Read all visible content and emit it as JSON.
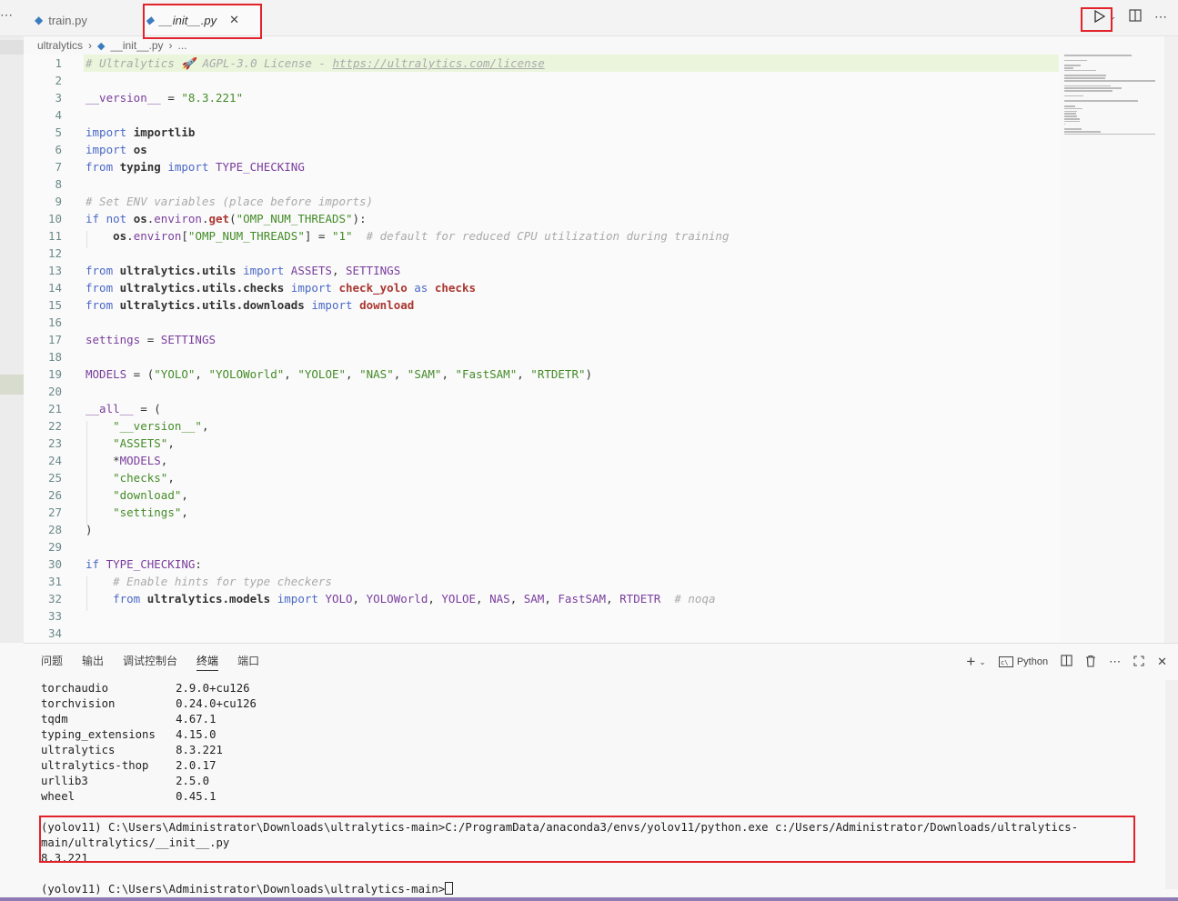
{
  "tabs": [
    {
      "name": "train.py",
      "active": false
    },
    {
      "name": "__init__.py",
      "active": true
    }
  ],
  "breadcrumb": {
    "folder": "ultralytics",
    "file": "__init__.py",
    "more": "..."
  },
  "editor_lines": [
    {
      "n": "1",
      "tokens": [
        [
          "c-com",
          "# Ultralytics 🚀 AGPL-3.0 License - "
        ],
        [
          "c-link",
          "https://ultralytics.com/license"
        ]
      ],
      "hl": true
    },
    {
      "n": "2",
      "tokens": []
    },
    {
      "n": "3",
      "tokens": [
        [
          "c-dun",
          "__version__"
        ],
        [
          "c-plain",
          " = "
        ],
        [
          "c-str",
          "\"8.3.221\""
        ]
      ]
    },
    {
      "n": "4",
      "tokens": []
    },
    {
      "n": "5",
      "tokens": [
        [
          "c-kw",
          "import "
        ],
        [
          "c-mod",
          "importlib"
        ]
      ]
    },
    {
      "n": "6",
      "tokens": [
        [
          "c-kw",
          "import "
        ],
        [
          "c-mod",
          "os"
        ]
      ]
    },
    {
      "n": "7",
      "tokens": [
        [
          "c-kw",
          "from "
        ],
        [
          "c-mod",
          "typing"
        ],
        [
          "c-kw",
          " import "
        ],
        [
          "c-cls",
          "TYPE_CHECKING"
        ]
      ]
    },
    {
      "n": "8",
      "tokens": []
    },
    {
      "n": "9",
      "tokens": [
        [
          "c-com",
          "# Set ENV variables (place before imports)"
        ]
      ]
    },
    {
      "n": "10",
      "tokens": [
        [
          "c-kw",
          "if not "
        ],
        [
          "c-mod",
          "os"
        ],
        [
          "c-plain",
          "."
        ],
        [
          "c-var",
          "environ"
        ],
        [
          "c-plain",
          "."
        ],
        [
          "c-fn",
          "get"
        ],
        [
          "c-plain",
          "("
        ],
        [
          "c-str",
          "\"OMP_NUM_THREADS\""
        ],
        [
          "c-plain",
          "):"
        ]
      ]
    },
    {
      "n": "11",
      "tokens": [
        [
          "c-plain",
          "    "
        ],
        [
          "c-mod",
          "os"
        ],
        [
          "c-plain",
          "."
        ],
        [
          "c-var",
          "environ"
        ],
        [
          "c-plain",
          "["
        ],
        [
          "c-str",
          "\"OMP_NUM_THREADS\""
        ],
        [
          "c-plain",
          "] = "
        ],
        [
          "c-str",
          "\"1\""
        ],
        [
          "c-plain",
          "  "
        ],
        [
          "c-com",
          "# default for reduced CPU utilization during training"
        ]
      ]
    },
    {
      "n": "12",
      "tokens": []
    },
    {
      "n": "13",
      "tokens": [
        [
          "c-kw",
          "from "
        ],
        [
          "c-mod",
          "ultralytics.utils"
        ],
        [
          "c-kw",
          " import "
        ],
        [
          "c-cls",
          "ASSETS"
        ],
        [
          "c-plain",
          ", "
        ],
        [
          "c-cls",
          "SETTINGS"
        ]
      ]
    },
    {
      "n": "14",
      "tokens": [
        [
          "c-kw",
          "from "
        ],
        [
          "c-mod",
          "ultralytics.utils.checks"
        ],
        [
          "c-kw",
          " import "
        ],
        [
          "c-fn",
          "check_yolo"
        ],
        [
          "c-kw",
          " as "
        ],
        [
          "c-fn",
          "checks"
        ]
      ]
    },
    {
      "n": "15",
      "tokens": [
        [
          "c-kw",
          "from "
        ],
        [
          "c-mod",
          "ultralytics.utils.downloads"
        ],
        [
          "c-kw",
          " import "
        ],
        [
          "c-fn",
          "download"
        ]
      ]
    },
    {
      "n": "16",
      "tokens": []
    },
    {
      "n": "17",
      "tokens": [
        [
          "c-var",
          "settings"
        ],
        [
          "c-plain",
          " = "
        ],
        [
          "c-cls",
          "SETTINGS"
        ]
      ]
    },
    {
      "n": "18",
      "tokens": []
    },
    {
      "n": "19",
      "tokens": [
        [
          "c-cls",
          "MODELS"
        ],
        [
          "c-plain",
          " = ("
        ],
        [
          "c-str",
          "\"YOLO\""
        ],
        [
          "c-plain",
          ", "
        ],
        [
          "c-str",
          "\"YOLOWorld\""
        ],
        [
          "c-plain",
          ", "
        ],
        [
          "c-str",
          "\"YOLOE\""
        ],
        [
          "c-plain",
          ", "
        ],
        [
          "c-str",
          "\"NAS\""
        ],
        [
          "c-plain",
          ", "
        ],
        [
          "c-str",
          "\"SAM\""
        ],
        [
          "c-plain",
          ", "
        ],
        [
          "c-str",
          "\"FastSAM\""
        ],
        [
          "c-plain",
          ", "
        ],
        [
          "c-str",
          "\"RTDETR\""
        ],
        [
          "c-plain",
          ")"
        ]
      ]
    },
    {
      "n": "20",
      "tokens": []
    },
    {
      "n": "21",
      "tokens": [
        [
          "c-dun",
          "__all__"
        ],
        [
          "c-plain",
          " = ("
        ]
      ]
    },
    {
      "n": "22",
      "tokens": [
        [
          "c-plain",
          "    "
        ],
        [
          "c-str",
          "\"__version__\""
        ],
        [
          "c-plain",
          ","
        ]
      ]
    },
    {
      "n": "23",
      "tokens": [
        [
          "c-plain",
          "    "
        ],
        [
          "c-str",
          "\"ASSETS\""
        ],
        [
          "c-plain",
          ","
        ]
      ]
    },
    {
      "n": "24",
      "tokens": [
        [
          "c-plain",
          "    *"
        ],
        [
          "c-cls",
          "MODELS"
        ],
        [
          "c-plain",
          ","
        ]
      ]
    },
    {
      "n": "25",
      "tokens": [
        [
          "c-plain",
          "    "
        ],
        [
          "c-str",
          "\"checks\""
        ],
        [
          "c-plain",
          ","
        ]
      ]
    },
    {
      "n": "26",
      "tokens": [
        [
          "c-plain",
          "    "
        ],
        [
          "c-str",
          "\"download\""
        ],
        [
          "c-plain",
          ","
        ]
      ]
    },
    {
      "n": "27",
      "tokens": [
        [
          "c-plain",
          "    "
        ],
        [
          "c-str",
          "\"settings\""
        ],
        [
          "c-plain",
          ","
        ]
      ]
    },
    {
      "n": "28",
      "tokens": [
        [
          "c-plain",
          ")"
        ]
      ]
    },
    {
      "n": "29",
      "tokens": []
    },
    {
      "n": "30",
      "tokens": [
        [
          "c-kw",
          "if "
        ],
        [
          "c-cls",
          "TYPE_CHECKING"
        ],
        [
          "c-plain",
          ":"
        ]
      ]
    },
    {
      "n": "31",
      "tokens": [
        [
          "c-plain",
          "    "
        ],
        [
          "c-com",
          "# Enable hints for type checkers"
        ]
      ]
    },
    {
      "n": "32",
      "tokens": [
        [
          "c-plain",
          "    "
        ],
        [
          "c-kw",
          "from "
        ],
        [
          "c-mod",
          "ultralytics.models"
        ],
        [
          "c-kw",
          " import "
        ],
        [
          "c-cls",
          "YOLO"
        ],
        [
          "c-plain",
          ", "
        ],
        [
          "c-cls",
          "YOLOWorld"
        ],
        [
          "c-plain",
          ", "
        ],
        [
          "c-cls",
          "YOLOE"
        ],
        [
          "c-plain",
          ", "
        ],
        [
          "c-cls",
          "NAS"
        ],
        [
          "c-plain",
          ", "
        ],
        [
          "c-cls",
          "SAM"
        ],
        [
          "c-plain",
          ", "
        ],
        [
          "c-cls",
          "FastSAM"
        ],
        [
          "c-plain",
          ", "
        ],
        [
          "c-cls",
          "RTDETR"
        ],
        [
          "c-plain",
          "  "
        ],
        [
          "c-com",
          "# noqa"
        ]
      ]
    },
    {
      "n": "33",
      "tokens": []
    },
    {
      "n": "34",
      "tokens": []
    }
  ],
  "panel": {
    "tabs": [
      "问题",
      "输出",
      "调试控制台",
      "终端",
      "端口"
    ],
    "active_tab": "终端",
    "shell_label": "Python"
  },
  "terminal_lines": [
    "torchaudio          2.9.0+cu126",
    "torchvision         0.24.0+cu126",
    "tqdm                4.67.1",
    "typing_extensions   4.15.0",
    "ultralytics         8.3.221",
    "ultralytics-thop    2.0.17",
    "urllib3             2.5.0",
    "wheel               0.45.1",
    "",
    "(yolov11) C:\\Users\\Administrator\\Downloads\\ultralytics-main>C:/ProgramData/anaconda3/envs/yolov11/python.exe c:/Users/Administrator/Downloads/ultralytics-",
    "main/ultralytics/__init__.py",
    "8.3.221",
    "",
    "(yolov11) C:\\Users\\Administrator\\Downloads\\ultralytics-main>"
  ],
  "colors": {
    "highlight_box": "#e3232c",
    "accent": "#8e7bb4"
  }
}
